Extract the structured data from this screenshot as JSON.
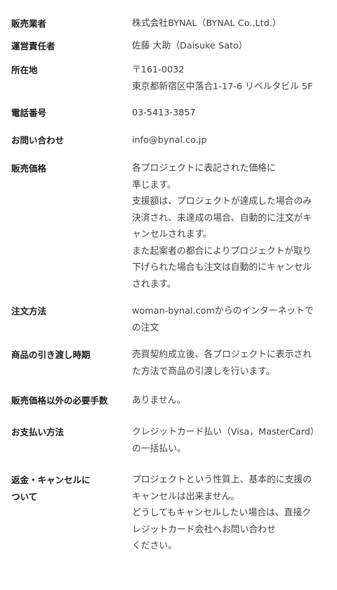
{
  "rows": [
    {
      "label": [
        "販売業者"
      ],
      "value": [
        "株式会社BYNAL（BYNAL Co.,Ltd.）"
      ]
    },
    {
      "label": [
        "運営責任者"
      ],
      "value": [
        "佐藤 大助（Daisuke Sato）"
      ]
    },
    {
      "label": [
        "所在地"
      ],
      "value": [
        "〒161-0032",
        "東京都新宿区中落合1-17-6 リベルタビル 5F"
      ]
    },
    {
      "label": [
        "電話番号"
      ],
      "value": [
        "03-5413-3857"
      ]
    },
    {
      "label": [
        "お問い合わせ"
      ],
      "value": [
        "info@bynal.co.jp"
      ]
    },
    {
      "label": [
        "販売価格"
      ],
      "value": [
        "各プロジェクトに表記された価格に",
        "準じます。",
        "支援額は、プロジェクトが達成した場合のみ",
        "決済され、未達成の場合、自動的に注文がキ",
        "ャンセルされます。",
        "また起案者の都合によりプロジェクトが取り",
        "下げられた場合も注文は自動的にキャンセル",
        "されます。"
      ]
    },
    {
      "label": [
        "注文方法"
      ],
      "value": [
        "woman-bynal.comからのインターネットで",
        "の注文"
      ]
    },
    {
      "label": [
        "商品の引き渡し時期"
      ],
      "value": [
        "売買契約成立後、各プロジェクトに表示され",
        "た方法で商品の引渡しを行います。"
      ]
    },
    {
      "label": [
        "販売価格以外の必要手数"
      ],
      "value": [
        "ありません。"
      ]
    },
    {
      "label": [
        "お支払い方法"
      ],
      "value": [
        "クレジットカード払い（Visa，MasterCard）",
        "の一括払い。"
      ]
    },
    {
      "label": [
        "返金・キャンセルに",
        "ついて"
      ],
      "value": [
        "プロジェクトという性質上、基本的に支援の",
        "キャンセルは出来ません。",
        "どうしてもキャンセルしたい場合は、直接ク",
        "レジットカード会社へお問い合わせ",
        "ください。"
      ]
    }
  ]
}
